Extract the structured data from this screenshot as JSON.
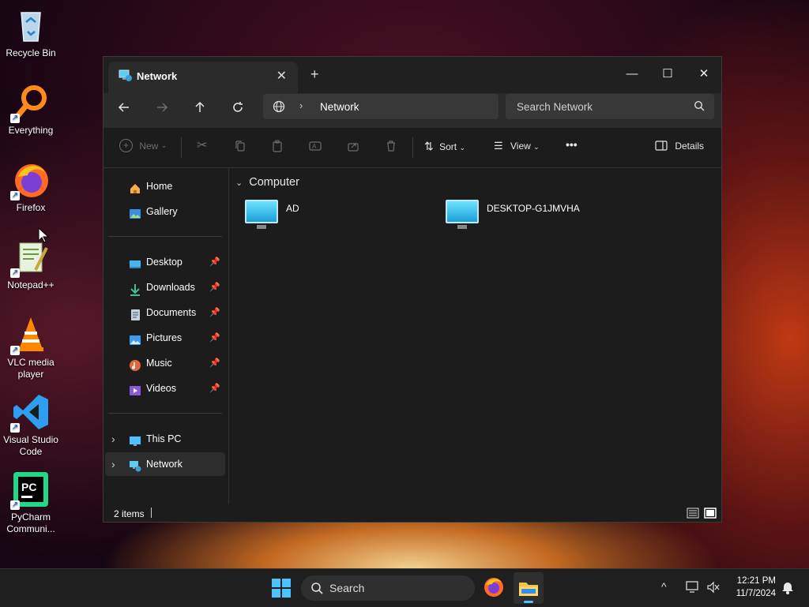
{
  "desktop": {
    "icons": [
      {
        "label": "Recycle Bin",
        "icon": "recycle-bin-icon"
      },
      {
        "label": "Everything",
        "icon": "everything-search-icon"
      },
      {
        "label": "Firefox",
        "icon": "firefox-icon"
      },
      {
        "label": "Notepad++",
        "icon": "notepad-plus-plus-icon"
      },
      {
        "label_line1": "VLC media",
        "label_line2": "player",
        "icon": "vlc-icon"
      },
      {
        "label_line1": "Visual Studio",
        "label_line2": "Code",
        "icon": "vscode-icon"
      },
      {
        "label_line1": "PyCharm",
        "label_line2": "Communi...",
        "icon": "pycharm-icon"
      }
    ]
  },
  "window": {
    "tab_title": "Network",
    "tab_close": "✕",
    "new_tab": "+",
    "controls": {
      "minimize": "—",
      "maximize": "☐",
      "close": "✕"
    }
  },
  "address": {
    "path": "Network",
    "search_placeholder": "Search Network"
  },
  "commands": {
    "new": "New",
    "sort": "Sort",
    "view": "View",
    "more": "•••",
    "details": "Details"
  },
  "nav": {
    "home": "Home",
    "gallery": "Gallery",
    "desktop": "Desktop",
    "downloads": "Downloads",
    "documents": "Documents",
    "pictures": "Pictures",
    "music": "Music",
    "videos": "Videos",
    "this_pc": "This PC",
    "network": "Network"
  },
  "content": {
    "group_header": "Computer",
    "items": [
      {
        "name": "AD"
      },
      {
        "name": "DESKTOP-G1JMVHA"
      }
    ]
  },
  "status": {
    "item_count": "2 items"
  },
  "taskbar": {
    "search_label": "Search",
    "time": "12:21 PM",
    "date": "11/7/2024"
  },
  "colors": {
    "accent": "#4cc2ff",
    "selected_nav": "#2d2d2d",
    "window_bg": "#1c1c1c"
  }
}
